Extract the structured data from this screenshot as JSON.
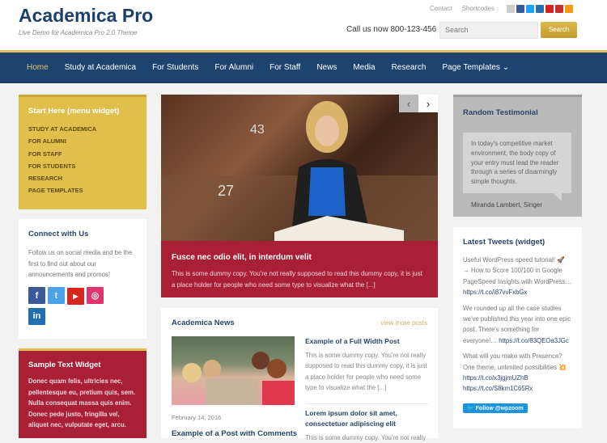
{
  "header": {
    "logo": "Academica Pro",
    "tagline": "Live Demo for Academica Pro 2.0 Theme",
    "links": [
      "Contact",
      "Shortcodes"
    ],
    "social_icons": [
      {
        "name": "email-icon",
        "color": "#cccccc"
      },
      {
        "name": "facebook-icon",
        "color": "#3b5998"
      },
      {
        "name": "twitter-icon",
        "color": "#1da1f2"
      },
      {
        "name": "vimeo-icon",
        "color": "#2a6fb0"
      },
      {
        "name": "yelp-icon",
        "color": "#d32323"
      },
      {
        "name": "youtube-icon",
        "color": "#c4302b"
      },
      {
        "name": "rss-icon",
        "color": "#f39c12"
      }
    ],
    "call": "Call us now 800-123-456",
    "search_placeholder": "Search",
    "search_button": "Search"
  },
  "nav": [
    "Home",
    "Study at Academica",
    "For Students",
    "For Alumni",
    "For Staff",
    "News",
    "Media",
    "Research",
    "Page Templates ⌄"
  ],
  "left": {
    "menu_widget": {
      "title": "Start Here (menu widget)",
      "items": [
        "STUDY AT ACADEMICA",
        "FOR ALUMNI",
        "FOR STAFF",
        "FOR STUDENTS",
        "RESEARCH",
        "PAGE TEMPLATES"
      ]
    },
    "connect": {
      "title": "Connect with Us",
      "text": "Follow us on social media and be the first to find out about our announcements and promos!",
      "icons": [
        "f",
        "t",
        "▶",
        "◎",
        "in"
      ]
    },
    "text_widget": {
      "title": "Sample Text Widget",
      "text": "Donec quam felis, ultricies nec, pellentesque eu, pretium quis, sem. Nulla consequat massa quis enim. Donec pede justo, fringilla vel, aliquet nec, vulputate eget, arcu."
    }
  },
  "slider": {
    "title": "Fusce nec odio elit, in interdum velit",
    "text": "This is some dummy copy. You're not really supposed to read this dummy copy, it is just a place holder for people who need some type to visualize what the [...]",
    "prev": "‹",
    "next": "›"
  },
  "news": {
    "title": "Academica News",
    "more": "view more posts",
    "date": "February 14, 2016",
    "featured_title": "Example of a Post with Comments",
    "posts": [
      {
        "title": "Example of a Full Width Post",
        "text": "This is some dummy copy. You're not really supposed to read this dummy copy, it is just a place holder for people who need some type to visualize what the [...]"
      },
      {
        "title": "Lorem ipsum dolor sit amet, consectetuer adipiscing elit",
        "text": "This is some dummy copy. You're not really"
      }
    ]
  },
  "right": {
    "testimonial": {
      "title": "Random Testimonial",
      "quote": "In today's competitive market environment, the body copy of your entry must lead the reader through a series of disarmingly simple thoughts.",
      "author": "Miranda Lambert, Singer"
    },
    "tweets": {
      "title": "Latest Tweets (widget)",
      "items": [
        {
          "text": "Useful WordPress speed tutorial! 🚀 → How to Score 100/100 in Google PageSpeed Insights with WordPress… ",
          "link": "https://t.co/i87vvFxbGx"
        },
        {
          "text": "We rounded up all the case studies we've published this year into one epic post. There's something for everyone!… ",
          "link": "https://t.co/83QEOa3JGc"
        },
        {
          "text": "What will you make with Presence? One theme, unlimited possibilities 💥 ",
          "link": "https://t.co/x3jgjmUZhB https://t.co/S8km1C65Rx"
        }
      ],
      "follow": "🐦 Follow @wpzoom"
    }
  }
}
